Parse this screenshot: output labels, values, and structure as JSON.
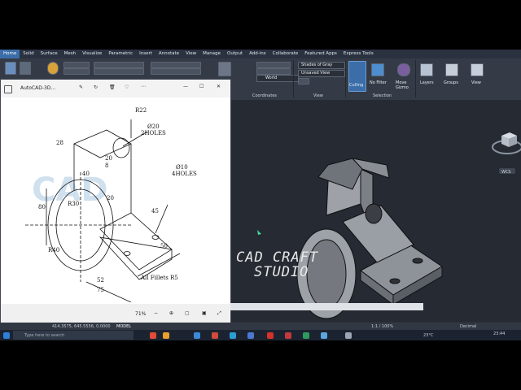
{
  "ribbon": {
    "tabs": [
      "Home",
      "Solid",
      "Surface",
      "Mesh",
      "Visualize",
      "Parametric",
      "Insert",
      "Annotate",
      "View",
      "Manage",
      "Output",
      "Add-ins",
      "Collaborate",
      "Featured Apps",
      "Express Tools"
    ],
    "visual_style": "Shades of Gray",
    "view_name": "Unsaved View",
    "layer": "World",
    "culling_label": "Culling",
    "no_filter_label": "No Filter",
    "move_gizmo_label": "Move Gizmo",
    "layers_label": "Layers",
    "groups_label": "Groups",
    "view_label": "View",
    "panel_coordinates": "Coordinates",
    "panel_view": "View",
    "panel_selection": "Selection"
  },
  "image_window": {
    "title": "AutoCAD-3D...",
    "zoom": "71%"
  },
  "drawing": {
    "r22": "R22",
    "d20": "Ø20",
    "holes2": "2HOLES",
    "d10": "Ø10",
    "holes4": "4HOLES",
    "dim28": "28",
    "dim20": "20",
    "dim8": "8",
    "dim40": "40",
    "dim80": "80",
    "r30": "R30",
    "r40": "R40",
    "dim20b": "20",
    "dim45": "45",
    "dim50": "50",
    "dim52": "52",
    "dim75": "75",
    "fillets": "All Fillets R5",
    "watermark": "CAD"
  },
  "overlay_text": {
    "line1": "CAD CRAFT",
    "line2": "STUDIO"
  },
  "viewcube": {
    "wcs": "WCS"
  },
  "status": {
    "coords": "414.3575, 645.5556, 0.0000",
    "model": "MODEL",
    "scale": "1:1 / 100%",
    "units": "Decimal"
  },
  "taskbar": {
    "search_placeholder": "Type here to search",
    "temp": "23°C",
    "time": "23:44"
  },
  "colors": {
    "ribbon_bg": "#353b46",
    "viewport_bg": "#252a33",
    "accent": "#3b6ea8",
    "overlay_text": "#e8e8e8"
  }
}
